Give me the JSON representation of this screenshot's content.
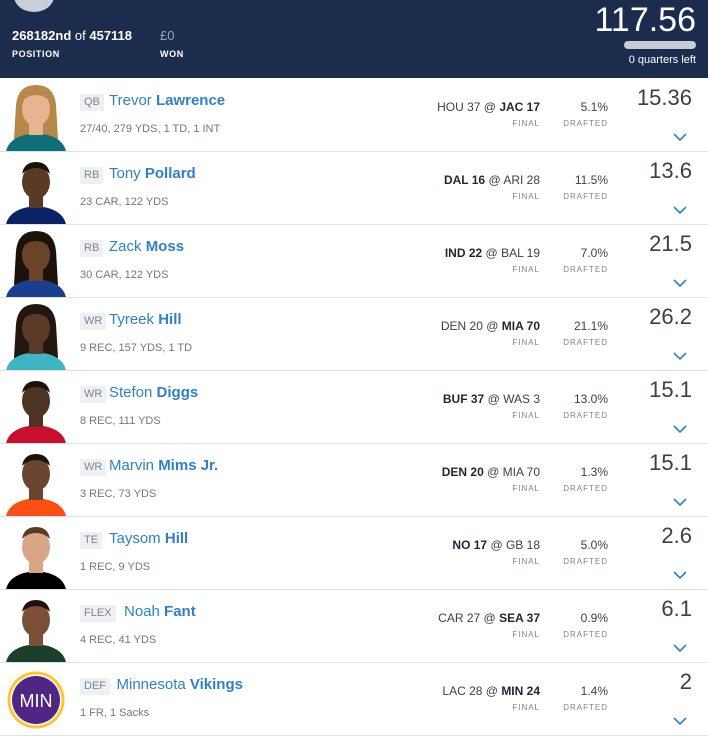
{
  "header": {
    "rank": "268182nd",
    "of_label": "of",
    "total_entries": "457118",
    "position_label": "POSITION",
    "won": "£0",
    "won_label": "WON",
    "total_points": "117.56",
    "quarters_left": "0 quarters left"
  },
  "colors": {
    "header_bg": "#1c2c4d",
    "link_blue": "#2f80c8",
    "vikings_purple": "#4f2683",
    "vikings_gold": "#ffc62f"
  },
  "players": [
    {
      "pos": "QB",
      "first": "Trevor",
      "last": "Lawrence",
      "stats": "27/40, 279 YDS, 1 TD, 1 INT",
      "game_pre": "HOU 37",
      "game_at": "@",
      "game_post": "JAC 17",
      "bold_side": "right",
      "final": "FINAL",
      "drafted": "5.1%",
      "drafted_label": "DRAFTED",
      "points": "15.36",
      "photo": "player-photo"
    },
    {
      "pos": "RB",
      "first": "Tony",
      "last": "Pollard",
      "stats": "23 CAR, 122 YDS",
      "game_pre": "DAL 16",
      "game_at": "@",
      "game_post": "ARI 28",
      "bold_side": "left",
      "final": "FINAL",
      "drafted": "11.5%",
      "drafted_label": "DRAFTED",
      "points": "13.6",
      "photo": "player-photo"
    },
    {
      "pos": "RB",
      "first": "Zack",
      "last": "Moss",
      "stats": "30 CAR, 122 YDS",
      "game_pre": "IND 22",
      "game_at": "@",
      "game_post": "BAL 19",
      "bold_side": "left",
      "final": "FINAL",
      "drafted": "7.0%",
      "drafted_label": "DRAFTED",
      "points": "21.5",
      "photo": "player-photo"
    },
    {
      "pos": "WR",
      "first": "Tyreek",
      "last": "Hill",
      "stats": "9 REC, 157 YDS, 1 TD",
      "game_pre": "DEN 20",
      "game_at": "@",
      "game_post": "MIA 70",
      "bold_side": "right",
      "final": "FINAL",
      "drafted": "21.1%",
      "drafted_label": "DRAFTED",
      "points": "26.2",
      "photo": "player-photo"
    },
    {
      "pos": "WR",
      "first": "Stefon",
      "last": "Diggs",
      "stats": "8 REC, 111 YDS",
      "game_pre": "BUF 37",
      "game_at": "@",
      "game_post": "WAS 3",
      "bold_side": "left",
      "final": "FINAL",
      "drafted": "13.0%",
      "drafted_label": "DRAFTED",
      "points": "15.1",
      "photo": "player-photo"
    },
    {
      "pos": "WR",
      "first": "Marvin",
      "last": "Mims Jr.",
      "stats": "3 REC, 73 YDS",
      "game_pre": "DEN 20",
      "game_at": "@",
      "game_post": "MIA 70",
      "bold_side": "left",
      "final": "FINAL",
      "drafted": "1.3%",
      "drafted_label": "DRAFTED",
      "points": "15.1",
      "photo": "player-photo"
    },
    {
      "pos": "TE",
      "first": "Taysom",
      "last": "Hill",
      "stats": "1 REC, 9 YDS",
      "game_pre": "NO 17",
      "game_at": "@",
      "game_post": "GB 18",
      "bold_side": "left",
      "final": "FINAL",
      "drafted": "5.0%",
      "drafted_label": "DRAFTED",
      "points": "2.6",
      "photo": "player-photo"
    },
    {
      "pos": "FLEX",
      "first": "Noah",
      "last": "Fant",
      "stats": "4 REC, 41 YDS",
      "game_pre": "CAR 27",
      "game_at": "@",
      "game_post": "SEA 37",
      "bold_side": "right",
      "final": "FINAL",
      "drafted": "0.9%",
      "drafted_label": "DRAFTED",
      "points": "6.1",
      "photo": "player-photo"
    },
    {
      "pos": "DEF",
      "first": "Minnesota",
      "last": "Vikings",
      "stats": "1 FR, 1 Sacks",
      "game_pre": "LAC 28",
      "game_at": "@",
      "game_post": "MIN 24",
      "bold_side": "right",
      "final": "FINAL",
      "drafted": "1.4%",
      "drafted_label": "DRAFTED",
      "points": "2",
      "photo": "team-logo",
      "logo_text": "MIN"
    }
  ]
}
